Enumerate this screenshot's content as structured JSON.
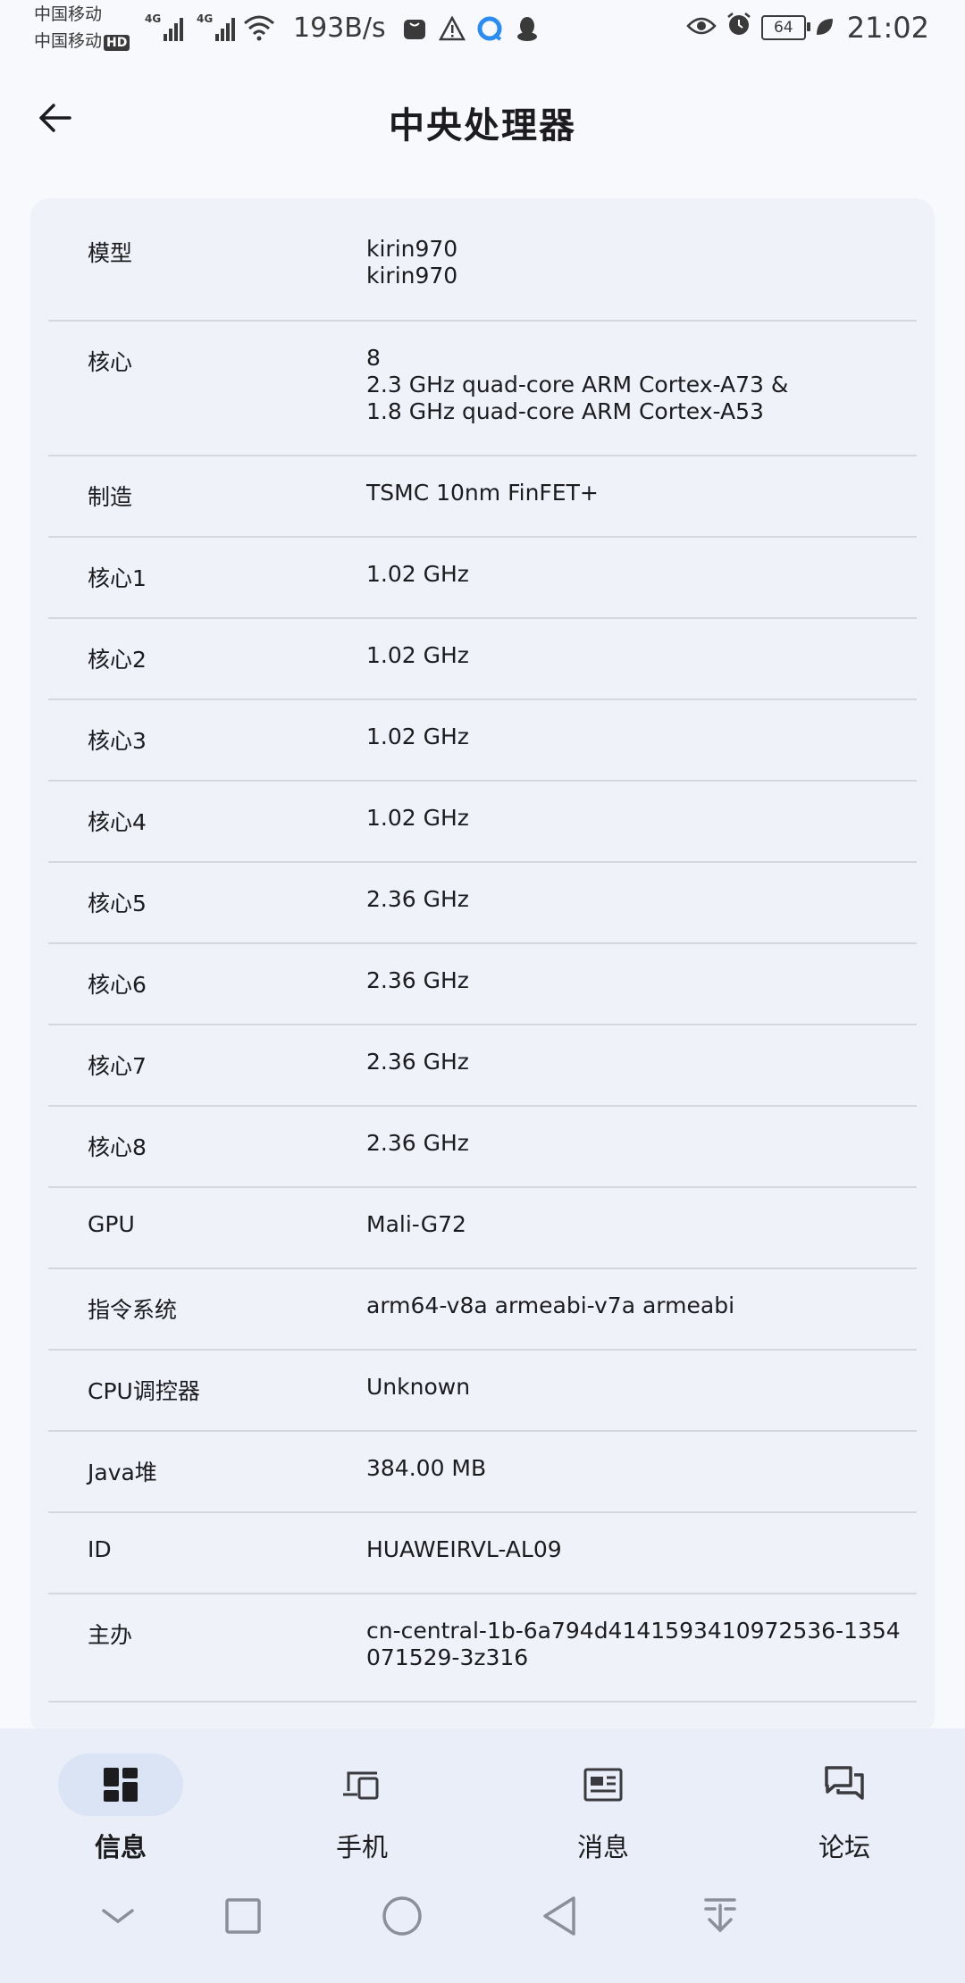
{
  "status_bar": {
    "carrier1": "中国移动",
    "carrier2": "中国移动",
    "hd_badge": "HD",
    "network_type": "4G",
    "net_speed": "193B/s",
    "battery_level": "64",
    "time": "21:02"
  },
  "header": {
    "title": "中央处理器"
  },
  "cpu_info": {
    "rows": [
      {
        "label": "模型",
        "value": "kirin970\nkirin970"
      },
      {
        "label": "核心",
        "value": "8\n2.3 GHz quad-core ARM Cortex-A73 &\n1.8 GHz quad-core ARM Cortex-A53"
      },
      {
        "label": "制造",
        "value": "TSMC 10nm FinFET+"
      },
      {
        "label": "核心1",
        "value": "1.02 GHz"
      },
      {
        "label": "核心2",
        "value": "1.02 GHz"
      },
      {
        "label": "核心3",
        "value": "1.02 GHz"
      },
      {
        "label": "核心4",
        "value": "1.02 GHz"
      },
      {
        "label": "核心5",
        "value": "2.36 GHz"
      },
      {
        "label": "核心6",
        "value": "2.36 GHz"
      },
      {
        "label": "核心7",
        "value": "2.36 GHz"
      },
      {
        "label": "核心8",
        "value": "2.36 GHz"
      },
      {
        "label": "GPU",
        "value": "Mali-G72"
      },
      {
        "label": "指令系统",
        "value": "arm64-v8a armeabi-v7a armeabi"
      },
      {
        "label": "CPU调控器",
        "value": "Unknown"
      },
      {
        "label": "Java堆",
        "value": "384.00 MB"
      },
      {
        "label": "ID",
        "value": "HUAWEIRVL-AL09"
      },
      {
        "label": "主办",
        "value": "cn-central-1b-6a794d4141593410972536-1354\n071529-3z316"
      }
    ]
  },
  "bottom_nav": {
    "items": [
      {
        "label": "信息",
        "icon": "dashboard-icon",
        "active": true
      },
      {
        "label": "手机",
        "icon": "devices-icon",
        "active": false
      },
      {
        "label": "消息",
        "icon": "news-icon",
        "active": false
      },
      {
        "label": "论坛",
        "icon": "forum-icon",
        "active": false
      }
    ]
  },
  "colors": {
    "background": "#f8f9fd",
    "card": "#eff2f9",
    "divider": "#d4d7de",
    "nav_bar": "#e9eef8",
    "nav_active_pill": "#dbe4f5",
    "text": "#1c1c1f"
  }
}
